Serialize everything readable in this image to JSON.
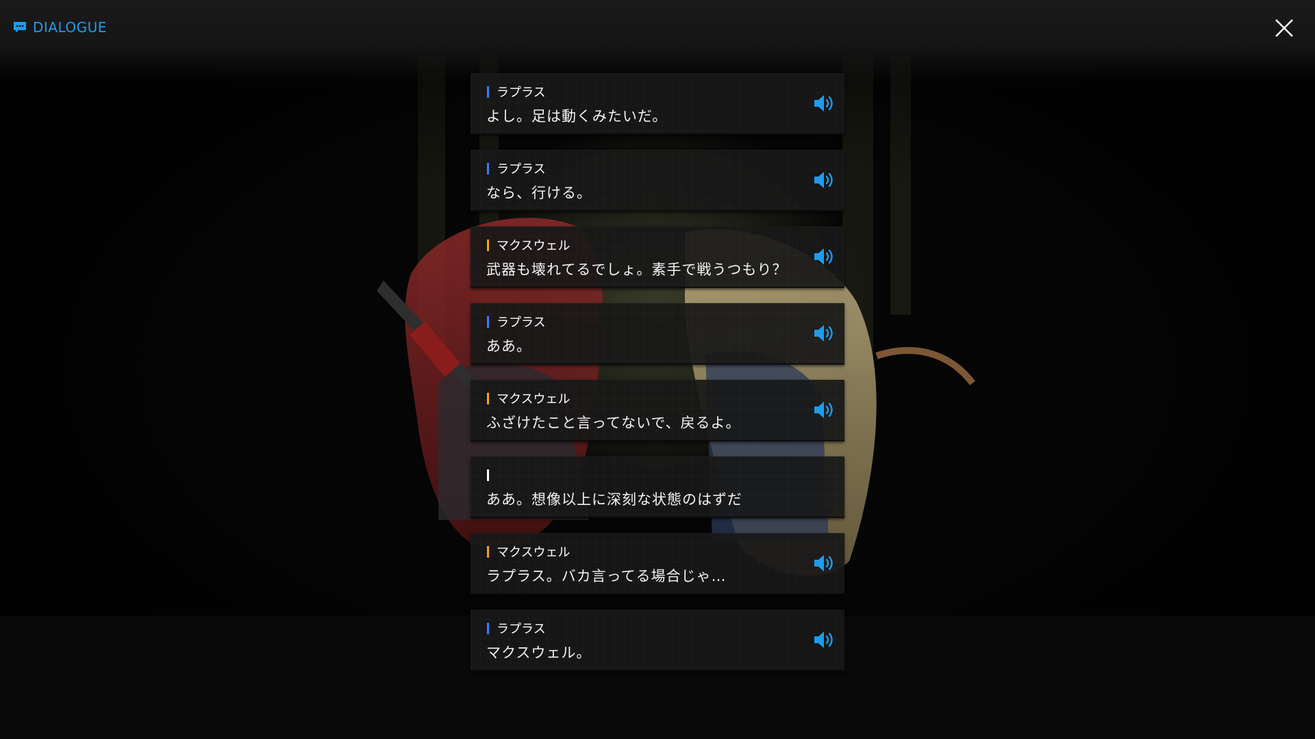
{
  "header": {
    "title": "DIALOGUE",
    "title_icon": "chat-bubble-icon",
    "close_icon": "close-icon"
  },
  "colors": {
    "accent": "#1d9cf0",
    "speaker_blue": "#3d7bff",
    "speaker_orange": "#f2a51a",
    "speaker_none": "#ffffff"
  },
  "dialogue": [
    {
      "speaker": "ラプラス",
      "speaker_color": "#3d7bff",
      "text": "よし。足は動くみたいだ。",
      "has_voice": true,
      "voice_icon": "speaker-volume-icon"
    },
    {
      "speaker": "ラプラス",
      "speaker_color": "#3d7bff",
      "text": "なら、行ける。",
      "has_voice": true,
      "voice_icon": "speaker-volume-icon"
    },
    {
      "speaker": "マクスウェル",
      "speaker_color": "#f2a51a",
      "text": "武器も壊れてるでしょ。素手で戦うつもり？",
      "has_voice": true,
      "voice_icon": "speaker-volume-icon"
    },
    {
      "speaker": "ラプラス",
      "speaker_color": "#3d7bff",
      "text": "ああ。",
      "has_voice": true,
      "voice_icon": "speaker-volume-icon"
    },
    {
      "speaker": "マクスウェル",
      "speaker_color": "#f2a51a",
      "text": "ふざけたこと言ってないで、戻るよ。",
      "has_voice": true,
      "voice_icon": "speaker-volume-icon"
    },
    {
      "speaker": "",
      "speaker_color": "#ffffff",
      "text": "ああ。想像以上に深刻な状態のはずだ",
      "has_voice": false,
      "voice_icon": ""
    },
    {
      "speaker": "マクスウェル",
      "speaker_color": "#f2a51a",
      "text": "ラプラス。バカ言ってる場合じゃ…",
      "has_voice": true,
      "voice_icon": "speaker-volume-icon"
    },
    {
      "speaker": "ラプラス",
      "speaker_color": "#3d7bff",
      "text": "マクスウェル。",
      "has_voice": true,
      "voice_icon": "speaker-volume-icon"
    }
  ]
}
